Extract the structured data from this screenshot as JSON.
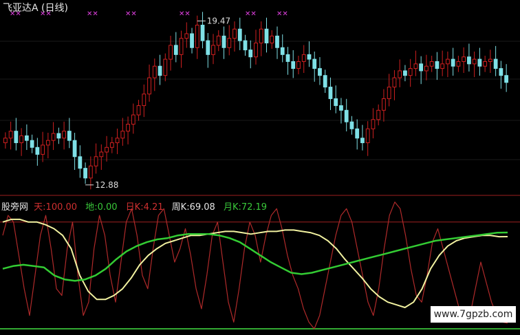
{
  "window_title": "飞亚达A (日线)",
  "indicator": {
    "name": "股旁网",
    "items": [
      {
        "label": "天:",
        "value": "100.00",
        "color": "#d03030"
      },
      {
        "label": "地:",
        "value": "0.00",
        "color": "#39c83a"
      },
      {
        "label": "日K:",
        "value": "4.21",
        "color": "#d03030"
      },
      {
        "label": "周K:",
        "value": "69.08",
        "color": "#e6e6e6"
      },
      {
        "label": "月K:",
        "value": "72.19",
        "color": "#39c83a"
      }
    ]
  },
  "watermark": "www.7gpzb.com",
  "colors": {
    "background": "#000000",
    "up": "#d02020",
    "down": "#7fe0e6",
    "daily_k": "#b02a2a",
    "weekly_k": "#f2f2a0",
    "monthly_k": "#33cc33",
    "marker": "#e040e0"
  },
  "chart_data": [
    {
      "type": "candlestick",
      "title": "飞亚达A (日线)",
      "annotations": [
        {
          "label": "19.47",
          "kind": "high"
        },
        {
          "label": "12.88",
          "kind": "low"
        }
      ],
      "closes": [
        14.6,
        14.9,
        14.4,
        14.7,
        14.5,
        14.2,
        13.9,
        14.3,
        14.5,
        14.8,
        14.6,
        14.9,
        14.5,
        13.8,
        13.3,
        12.88,
        13.4,
        13.8,
        14.0,
        14.2,
        14.4,
        14.6,
        14.9,
        15.2,
        15.6,
        16.0,
        16.5,
        17.2,
        17.7,
        17.3,
        18.0,
        18.6,
        18.2,
        18.9,
        19.1,
        18.5,
        19.47,
        18.8,
        18.2,
        18.6,
        19.0,
        18.5,
        18.9,
        19.3,
        18.8,
        18.4,
        18.1,
        18.7,
        19.3,
        18.7,
        19.0,
        18.5,
        18.2,
        17.9,
        17.6,
        17.9,
        18.2,
        18.0,
        17.6,
        17.3,
        16.8,
        16.3,
        16.0,
        15.8,
        15.3,
        15.0,
        14.6,
        14.4,
        15.0,
        15.4,
        15.8,
        16.3,
        16.8,
        17.2,
        17.5,
        17.3,
        17.6,
        17.8,
        17.5,
        17.7,
        17.9,
        17.6,
        17.8,
        18.0,
        17.7,
        17.9,
        18.1,
        17.8,
        18.0,
        17.7,
        17.9,
        18.0,
        17.6,
        17.3,
        17.0
      ],
      "ylim": [
        12.4,
        19.9
      ]
    },
    {
      "type": "line",
      "series": [
        {
          "name": "日K",
          "values": [
            70,
            85,
            80,
            55,
            30,
            10,
            40,
            70,
            85,
            60,
            30,
            25,
            60,
            80,
            40,
            10,
            20,
            60,
            85,
            70,
            40,
            20,
            50,
            80,
            90,
            70,
            40,
            30,
            60,
            85,
            90,
            70,
            50,
            60,
            75,
            55,
            30,
            15,
            40,
            70,
            80,
            50,
            20,
            5,
            30,
            60,
            80,
            70,
            50,
            70,
            85,
            90,
            75,
            55,
            40,
            30,
            15,
            5,
            0,
            10,
            30,
            50,
            70,
            85,
            90,
            80,
            60,
            40,
            20,
            10,
            30,
            60,
            85,
            95,
            90,
            70,
            45,
            25,
            20,
            40,
            65,
            75,
            60,
            45,
            30,
            15,
            5,
            10,
            30,
            50,
            35,
            20,
            10,
            5,
            4.21
          ]
        },
        {
          "name": "周K",
          "values": [
            80,
            82,
            82,
            80,
            80,
            78,
            75,
            70,
            60,
            40,
            28,
            22,
            22,
            25,
            30,
            38,
            48,
            55,
            60,
            64,
            66,
            68,
            70,
            70,
            71,
            72,
            73,
            73,
            72,
            71,
            72,
            73,
            73,
            74,
            74,
            73,
            72,
            70,
            66,
            60,
            52,
            45,
            38,
            30,
            24,
            20,
            18,
            16,
            20,
            30,
            45,
            55,
            62,
            66,
            68,
            69,
            70,
            70,
            69,
            69.08
          ]
        },
        {
          "name": "月K",
          "values": [
            45,
            47,
            48,
            47,
            46,
            40,
            37,
            36,
            37,
            40,
            45,
            52,
            58,
            62,
            65,
            67,
            68,
            70,
            71,
            71,
            71,
            70,
            68,
            65,
            60,
            55,
            50,
            46,
            42,
            41,
            42,
            44,
            46,
            48,
            50,
            52,
            54,
            56,
            58,
            60,
            62,
            64,
            66,
            67,
            68,
            69,
            70,
            71,
            72,
            72.19
          ]
        }
      ],
      "reference_lines": [
        100,
        80,
        0
      ],
      "ylim": [
        0,
        100
      ]
    }
  ]
}
